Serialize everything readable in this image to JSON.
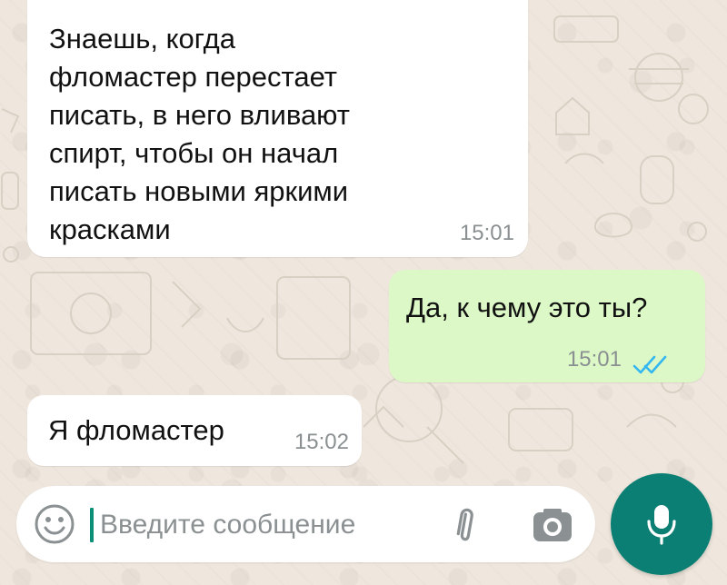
{
  "messages": [
    {
      "direction": "incoming",
      "text": "Знаешь, когда\nфломастер перестает\nписать, в него вливают\nспирт, чтобы он начал\nписать новыми яркими\nкрасками",
      "time": "15:01"
    },
    {
      "direction": "outgoing",
      "text": "Да, к чему это ты?",
      "time": "15:01",
      "status_icon": "double-check-icon"
    },
    {
      "direction": "incoming",
      "text": "Я фломастер",
      "time": "15:02"
    }
  ],
  "composer": {
    "placeholder": "Введите сообщение",
    "emoji_icon": "emoji-icon",
    "attach_icon": "paperclip-icon",
    "camera_icon": "camera-icon",
    "mic_icon": "microphone-icon"
  },
  "colors": {
    "wallpaper": "#efe7dd",
    "incoming_bubble": "#ffffff",
    "outgoing_bubble": "#dcf8c6",
    "accent": "#0b7f73",
    "read_ticks": "#34b7f1"
  }
}
